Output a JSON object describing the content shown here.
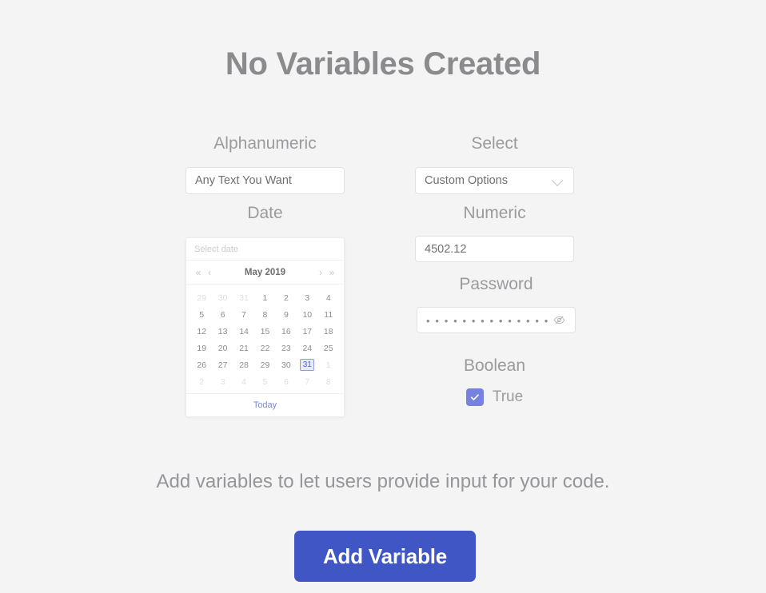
{
  "header": {
    "title": "No Variables Created"
  },
  "fields": {
    "alphanumeric": {
      "label": "Alphanumeric",
      "value": "Any Text You Want"
    },
    "select": {
      "label": "Select",
      "value": "Custom Options",
      "chevron_icon": "chevron-down-icon"
    },
    "date": {
      "label": "Date",
      "input_placeholder": "Select date",
      "month_label": "May 2019",
      "nav": {
        "prev_year": "«",
        "prev_month": "‹",
        "next_month": "›",
        "next_year": "»"
      },
      "today_label": "Today",
      "selected_day": "31",
      "weeks": [
        [
          {
            "d": "29",
            "muted": true
          },
          {
            "d": "30",
            "muted": true
          },
          {
            "d": "31",
            "muted": true
          },
          {
            "d": "1",
            "muted": false
          },
          {
            "d": "2",
            "muted": false
          },
          {
            "d": "3",
            "muted": false
          },
          {
            "d": "4",
            "muted": false
          }
        ],
        [
          {
            "d": "5",
            "muted": false
          },
          {
            "d": "6",
            "muted": false
          },
          {
            "d": "7",
            "muted": false
          },
          {
            "d": "8",
            "muted": false
          },
          {
            "d": "9",
            "muted": false
          },
          {
            "d": "10",
            "muted": false
          },
          {
            "d": "11",
            "muted": false
          }
        ],
        [
          {
            "d": "12",
            "muted": false
          },
          {
            "d": "13",
            "muted": false
          },
          {
            "d": "14",
            "muted": false
          },
          {
            "d": "15",
            "muted": false
          },
          {
            "d": "16",
            "muted": false
          },
          {
            "d": "17",
            "muted": false
          },
          {
            "d": "18",
            "muted": false
          }
        ],
        [
          {
            "d": "19",
            "muted": false
          },
          {
            "d": "20",
            "muted": false
          },
          {
            "d": "21",
            "muted": false
          },
          {
            "d": "22",
            "muted": false
          },
          {
            "d": "23",
            "muted": false
          },
          {
            "d": "24",
            "muted": false
          },
          {
            "d": "25",
            "muted": false
          }
        ],
        [
          {
            "d": "26",
            "muted": false
          },
          {
            "d": "27",
            "muted": false
          },
          {
            "d": "28",
            "muted": false
          },
          {
            "d": "29",
            "muted": false
          },
          {
            "d": "30",
            "muted": false
          },
          {
            "d": "31",
            "muted": false,
            "selected": true
          },
          {
            "d": "1",
            "muted": true
          }
        ],
        [
          {
            "d": "2",
            "muted": true
          },
          {
            "d": "3",
            "muted": true
          },
          {
            "d": "4",
            "muted": true
          },
          {
            "d": "5",
            "muted": true
          },
          {
            "d": "6",
            "muted": true
          },
          {
            "d": "7",
            "muted": true
          },
          {
            "d": "8",
            "muted": true
          }
        ]
      ]
    },
    "numeric": {
      "label": "Numeric",
      "value": "4502.12"
    },
    "password": {
      "label": "Password",
      "masked_value": "• • • • • • • • • • • • • •",
      "toggle_icon": "eye-slash-icon"
    },
    "boolean": {
      "label": "Boolean",
      "value_label": "True",
      "checked": true,
      "check_icon": "checkmark-icon"
    }
  },
  "footer": {
    "hint": "Add variables to let users provide input for your code.",
    "add_button_label": "Add Variable"
  },
  "colors": {
    "page_background": "#f4f4f5",
    "title_text": "#8b8b8d",
    "label_text": "#9b9b9d",
    "input_border": "#e2e2e4",
    "accent_button": "#4056c4",
    "accent_checkbox": "#7682e0",
    "accent_today_link": "#7785de",
    "selected_day_border": "#8c9ae8",
    "selected_day_fill": "#e8eaf8",
    "selected_day_text": "#4f63cc"
  }
}
